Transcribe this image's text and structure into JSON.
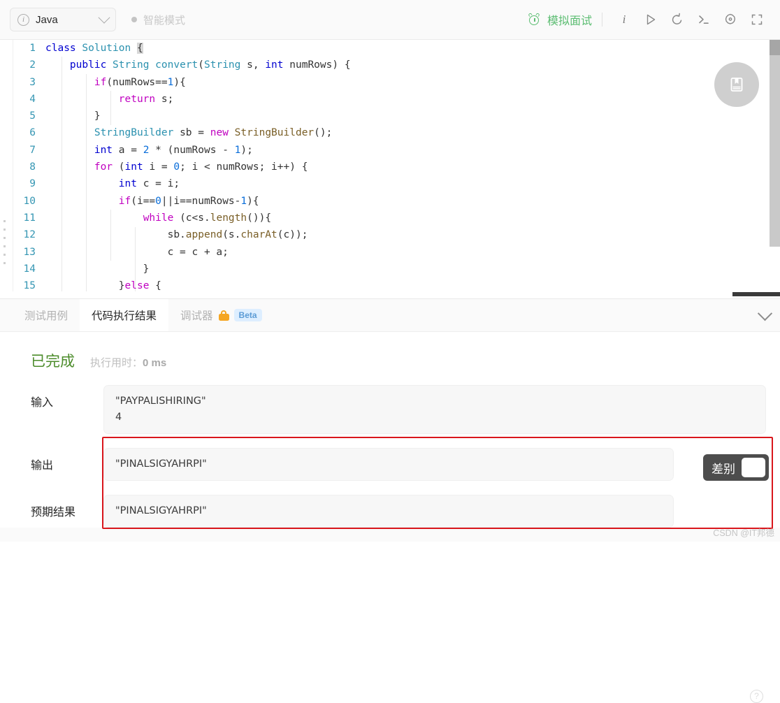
{
  "toolbar": {
    "language": "Java",
    "language_icon": "info-circle-icon",
    "smart_mode": "智能模式",
    "mock_interview": "模拟面试",
    "icons": {
      "clock": "alarm-clock-icon",
      "info": "i",
      "run": "play-icon",
      "reset": "undo-icon",
      "console": "terminal-icon",
      "settings": "gear-icon",
      "fullscreen": "fullscreen-icon"
    }
  },
  "editor": {
    "bookmark_icon": "notebook-icon",
    "lines": [
      {
        "n": "1",
        "tokens": [
          {
            "t": "class",
            "c": "k-kw"
          },
          {
            "t": " ",
            "c": "k-plain"
          },
          {
            "t": "Solution",
            "c": "k-type"
          },
          {
            "t": " ",
            "c": "k-plain"
          },
          {
            "t": "{",
            "c": "cursor-blk"
          }
        ]
      },
      {
        "n": "2",
        "tokens": [
          {
            "t": "    ",
            "c": "k-plain"
          },
          {
            "t": "public",
            "c": "k-kw"
          },
          {
            "t": " ",
            "c": "k-plain"
          },
          {
            "t": "String",
            "c": "k-type"
          },
          {
            "t": " ",
            "c": "k-plain"
          },
          {
            "t": "convert",
            "c": "k-type"
          },
          {
            "t": "(",
            "c": "k-plain"
          },
          {
            "t": "String",
            "c": "k-type"
          },
          {
            "t": " s, ",
            "c": "k-plain"
          },
          {
            "t": "int",
            "c": "k-kw"
          },
          {
            "t": " numRows) {",
            "c": "k-plain"
          }
        ]
      },
      {
        "n": "3",
        "tokens": [
          {
            "t": "        ",
            "c": "k-plain"
          },
          {
            "t": "if",
            "c": "k-mag"
          },
          {
            "t": "(numRows==",
            "c": "k-plain"
          },
          {
            "t": "1",
            "c": "k-num"
          },
          {
            "t": "){",
            "c": "k-plain"
          }
        ]
      },
      {
        "n": "4",
        "tokens": [
          {
            "t": "            ",
            "c": "k-plain"
          },
          {
            "t": "return",
            "c": "k-mag"
          },
          {
            "t": " s;",
            "c": "k-plain"
          }
        ]
      },
      {
        "n": "5",
        "tokens": [
          {
            "t": "        }",
            "c": "k-plain"
          }
        ]
      },
      {
        "n": "6",
        "tokens": [
          {
            "t": "        ",
            "c": "k-plain"
          },
          {
            "t": "StringBuilder",
            "c": "k-type"
          },
          {
            "t": " sb = ",
            "c": "k-plain"
          },
          {
            "t": "new",
            "c": "k-mag"
          },
          {
            "t": " ",
            "c": "k-plain"
          },
          {
            "t": "StringBuilder",
            "c": "k-fn"
          },
          {
            "t": "();",
            "c": "k-plain"
          }
        ]
      },
      {
        "n": "7",
        "tokens": [
          {
            "t": "        ",
            "c": "k-plain"
          },
          {
            "t": "int",
            "c": "k-kw"
          },
          {
            "t": " a = ",
            "c": "k-plain"
          },
          {
            "t": "2",
            "c": "k-num"
          },
          {
            "t": " * (numRows - ",
            "c": "k-plain"
          },
          {
            "t": "1",
            "c": "k-num"
          },
          {
            "t": ");",
            "c": "k-plain"
          }
        ]
      },
      {
        "n": "8",
        "tokens": [
          {
            "t": "        ",
            "c": "k-plain"
          },
          {
            "t": "for",
            "c": "k-mag"
          },
          {
            "t": " (",
            "c": "k-plain"
          },
          {
            "t": "int",
            "c": "k-kw"
          },
          {
            "t": " i = ",
            "c": "k-plain"
          },
          {
            "t": "0",
            "c": "k-num"
          },
          {
            "t": "; i < numRows; i++) {",
            "c": "k-plain"
          }
        ]
      },
      {
        "n": "9",
        "tokens": [
          {
            "t": "            ",
            "c": "k-plain"
          },
          {
            "t": "int",
            "c": "k-kw"
          },
          {
            "t": " c = i;",
            "c": "k-plain"
          }
        ]
      },
      {
        "n": "10",
        "tokens": [
          {
            "t": "            ",
            "c": "k-plain"
          },
          {
            "t": "if",
            "c": "k-mag"
          },
          {
            "t": "(i==",
            "c": "k-plain"
          },
          {
            "t": "0",
            "c": "k-num"
          },
          {
            "t": "||i==numRows-",
            "c": "k-plain"
          },
          {
            "t": "1",
            "c": "k-num"
          },
          {
            "t": "){",
            "c": "k-plain"
          }
        ]
      },
      {
        "n": "11",
        "tokens": [
          {
            "t": "                ",
            "c": "k-plain"
          },
          {
            "t": "while",
            "c": "k-mag"
          },
          {
            "t": " (c<s.",
            "c": "k-plain"
          },
          {
            "t": "length",
            "c": "k-fn"
          },
          {
            "t": "()){",
            "c": "k-plain"
          }
        ]
      },
      {
        "n": "12",
        "tokens": [
          {
            "t": "                    sb.",
            "c": "k-plain"
          },
          {
            "t": "append",
            "c": "k-fn"
          },
          {
            "t": "(s.",
            "c": "k-plain"
          },
          {
            "t": "charAt",
            "c": "k-fn"
          },
          {
            "t": "(c));",
            "c": "k-plain"
          }
        ]
      },
      {
        "n": "13",
        "tokens": [
          {
            "t": "                    c = c + a;",
            "c": "k-plain"
          }
        ]
      },
      {
        "n": "14",
        "tokens": [
          {
            "t": "                }",
            "c": "k-plain"
          }
        ]
      },
      {
        "n": "15",
        "tokens": [
          {
            "t": "            }",
            "c": "k-plain"
          },
          {
            "t": "else",
            "c": "k-mag"
          },
          {
            "t": " {",
            "c": "k-plain"
          }
        ]
      }
    ]
  },
  "panel": {
    "tabs": [
      {
        "label": "测试用例",
        "active": false,
        "lock": false,
        "badge": null
      },
      {
        "label": "代码执行结果",
        "active": true,
        "lock": false,
        "badge": null
      },
      {
        "label": "调试器",
        "active": false,
        "lock": true,
        "badge": "Beta"
      }
    ],
    "collapse_icon": "chevron-down-icon"
  },
  "result": {
    "status": "已完成",
    "runtime_label": "执行用时：",
    "runtime_value": "0 ms",
    "help_icon": "?",
    "fields": [
      {
        "label": "输入",
        "value": "\"PAYPALISHIRING\"\n4"
      },
      {
        "label": "输出",
        "value": "\"PINALSIGYAHRPI\""
      },
      {
        "label": "预期结果",
        "value": "\"PINALSIGYAHRPI\""
      }
    ],
    "diff_toggle": {
      "label": "差别",
      "on": false
    }
  },
  "watermark": "CSDN @IT邦德",
  "colors": {
    "accent_green": "#5cbd72",
    "status_green": "#4c8c2b",
    "highlight_red": "#d9161c",
    "beta_blue": "#5b9bd5",
    "lock_orange": "#f5a623"
  }
}
